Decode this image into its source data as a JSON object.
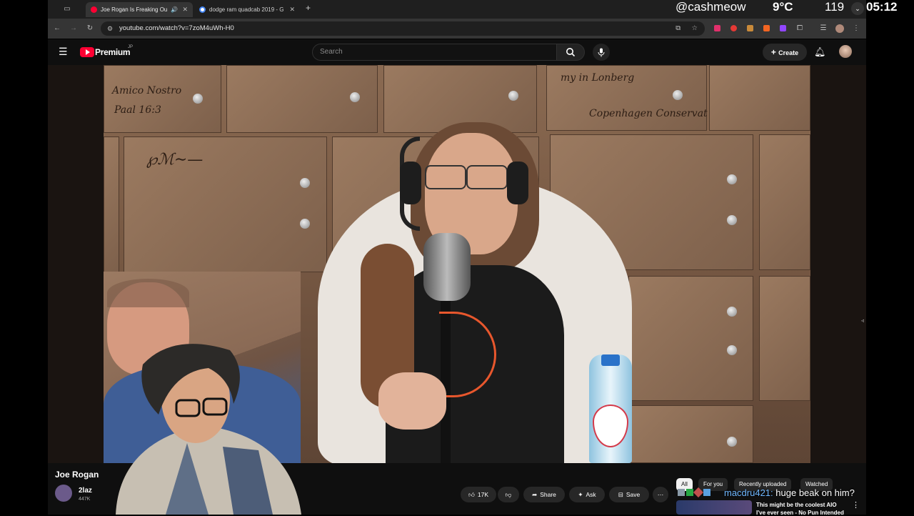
{
  "browser": {
    "tabs": [
      {
        "title": "Joe Rogan Is Freaking Ou",
        "active": true
      },
      {
        "title": "dodge ram quadcab 2019 - G",
        "active": false
      }
    ],
    "new_tab": "+",
    "url": "youtube.com/watch?v=7zoM4uWh-H0"
  },
  "overlay": {
    "handle": "@cashmeow",
    "temperature": "9°C",
    "count": "119",
    "time": "05:12"
  },
  "youtube": {
    "logo_text": "Premium",
    "logo_sup": "JP",
    "search_placeholder": "Search",
    "create_label": "Create"
  },
  "video": {
    "title_partial": "Joe Rogan",
    "channel_partial": "2laz",
    "subs_partial": "447K"
  },
  "actions": {
    "like_count": "17K",
    "share_label": "Share",
    "ask_label": "Ask",
    "save_label": "Save"
  },
  "filters": [
    "All",
    "For you",
    "Recently uploaded",
    "Watched"
  ],
  "chat": {
    "user": "macdru421:",
    "message": "huge beak on him?"
  },
  "recommended": {
    "title_line1": "This might be the coolest AIO",
    "title_line2": "I've ever seen - No Pun Intended"
  },
  "colors": {
    "youtube_red": "#ff0033",
    "chat_user": "#6fb7ff"
  }
}
